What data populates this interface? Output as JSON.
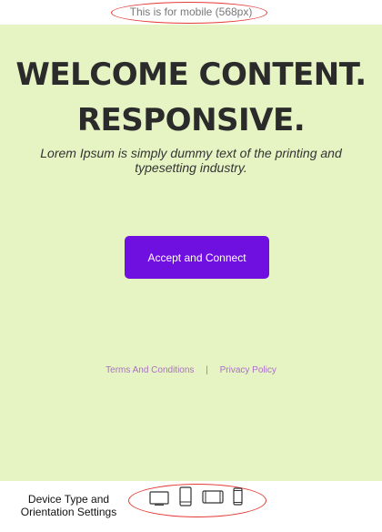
{
  "top_label": "This is for mobile (568px)",
  "preview": {
    "headline_line1": "WELCOME CONTENT.",
    "headline_line2": "RESPONSIVE.",
    "subtitle": "Lorem Ipsum is simply dummy text of the printing and typesetting industry.",
    "accept_button": "Accept and Connect",
    "footer": {
      "terms": "Terms And Conditions",
      "separator": "|",
      "privacy": "Privacy Policy"
    }
  },
  "bottom": {
    "settings_label": "Device Type and Orientation Settings",
    "device_icons": [
      "desktop-icon",
      "tablet-portrait-icon",
      "tablet-landscape-icon",
      "mobile-portrait-icon"
    ]
  },
  "colors": {
    "preview_background": "#e6f4c3",
    "accent": "#7010e0",
    "link": "#a970c6",
    "highlight_ellipse": "#e53935"
  }
}
